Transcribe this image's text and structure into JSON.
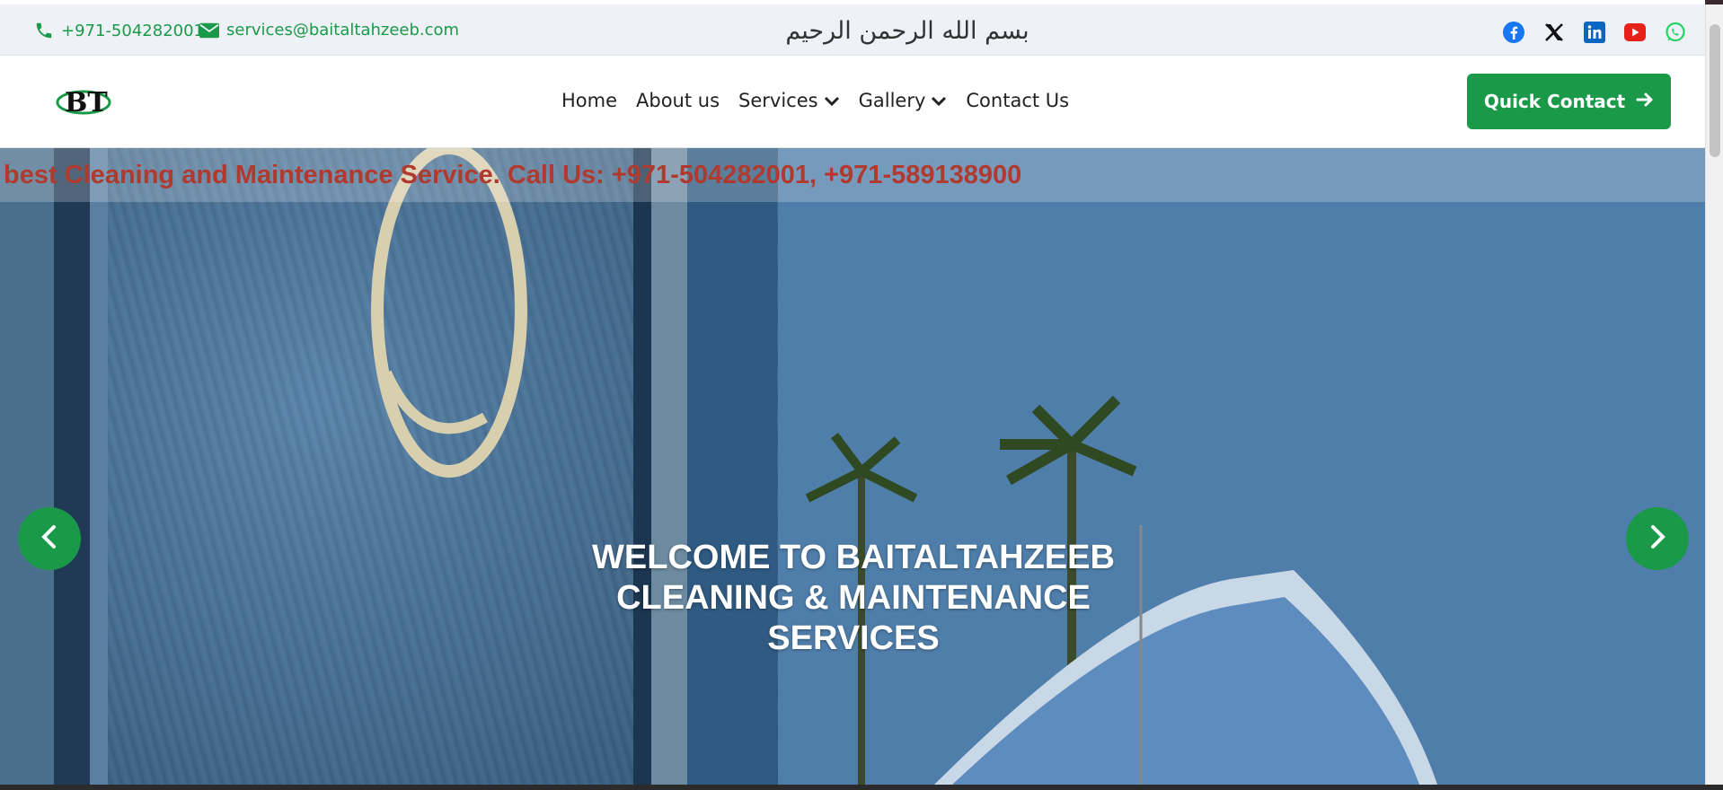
{
  "topbar": {
    "phone": "+971-504282001",
    "email": "services@baitaltahzeeb.com",
    "bismillah": "بسم الله الرحمن الرحيم",
    "socials": [
      {
        "icon": "facebook-icon",
        "color": "#1877f2"
      },
      {
        "icon": "x-icon",
        "color": "#000000"
      },
      {
        "icon": "linkedin-icon",
        "color": "#0a66c2"
      },
      {
        "icon": "youtube-icon",
        "color": "#e62117"
      },
      {
        "icon": "whatsapp-icon",
        "color": "#25d366"
      }
    ]
  },
  "nav": {
    "logo_text": "BT",
    "items": [
      {
        "label": "Home",
        "dropdown": false
      },
      {
        "label": "About us",
        "dropdown": false
      },
      {
        "label": "Services",
        "dropdown": true
      },
      {
        "label": "Gallery",
        "dropdown": true
      },
      {
        "label": "Contact Us",
        "dropdown": false
      }
    ],
    "quick_contact": "Quick Contact"
  },
  "hero": {
    "ticker": "best Cleaning and Maintenance Service. Call Us: +971-504282001, +971-589138900",
    "title": "WELCOME TO BAITALTAHZEEB CLEANING & MAINTENANCE SERVICES"
  },
  "colors": {
    "brand_green": "#1a9a48",
    "ticker_red": "#b03a2e"
  }
}
